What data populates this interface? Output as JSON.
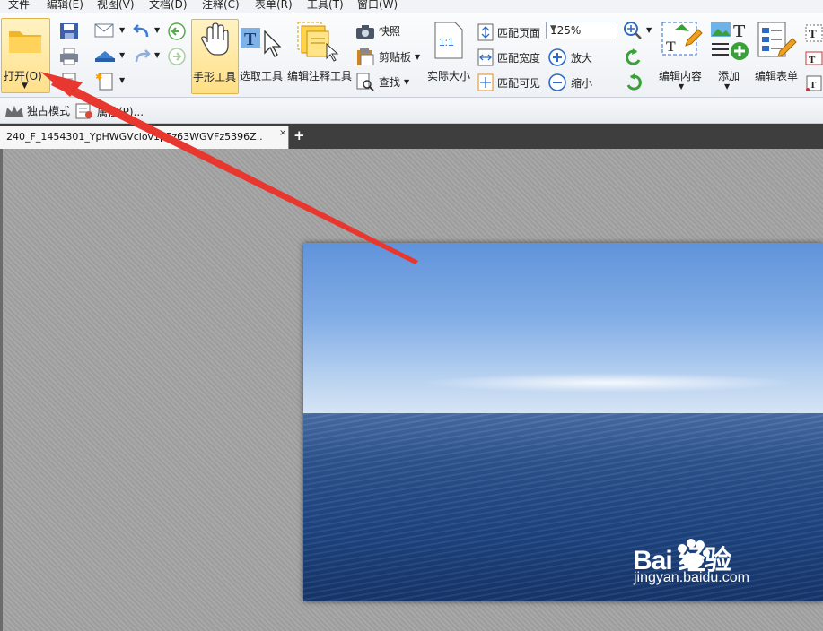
{
  "menu": [
    "文件",
    "编辑(E)",
    "视图(V)",
    "文档(D)",
    "注释(C)",
    "表单(R)",
    "工具(T)",
    "窗口(W)"
  ],
  "ribbon": {
    "open": "打开(O)",
    "hand_tool": "手形工具",
    "select_tool": "选取工具",
    "edit_annotation_tool": "编辑注释工具",
    "snapshot": "快照",
    "clipboard": "剪贴板",
    "find": "查找",
    "actual_size_icon": "1:1",
    "actual_size": "实际大小",
    "fit_page": "匹配页面",
    "fit_width": "匹配宽度",
    "fit_visible": "匹配可见",
    "zoom_value": "125%",
    "zoom_in": "放大",
    "zoom_out": "缩小",
    "edit_content": "编辑内容",
    "add": "添加",
    "edit_form": "编辑表单"
  },
  "toolbar2": {
    "exclusive_mode": "独占模式",
    "properties": "属性(P)..."
  },
  "tab": {
    "title": "240_F_1454301_YpHWGVciov1pFz63WGVFz5396Z..",
    "close": "×",
    "new_tab": "+"
  },
  "watermark": {
    "brand": "Bai 经验",
    "url": "jingyan.baidu.com"
  },
  "colors": {
    "highlight": "#ffe08a",
    "arrow": "#e8372f"
  }
}
